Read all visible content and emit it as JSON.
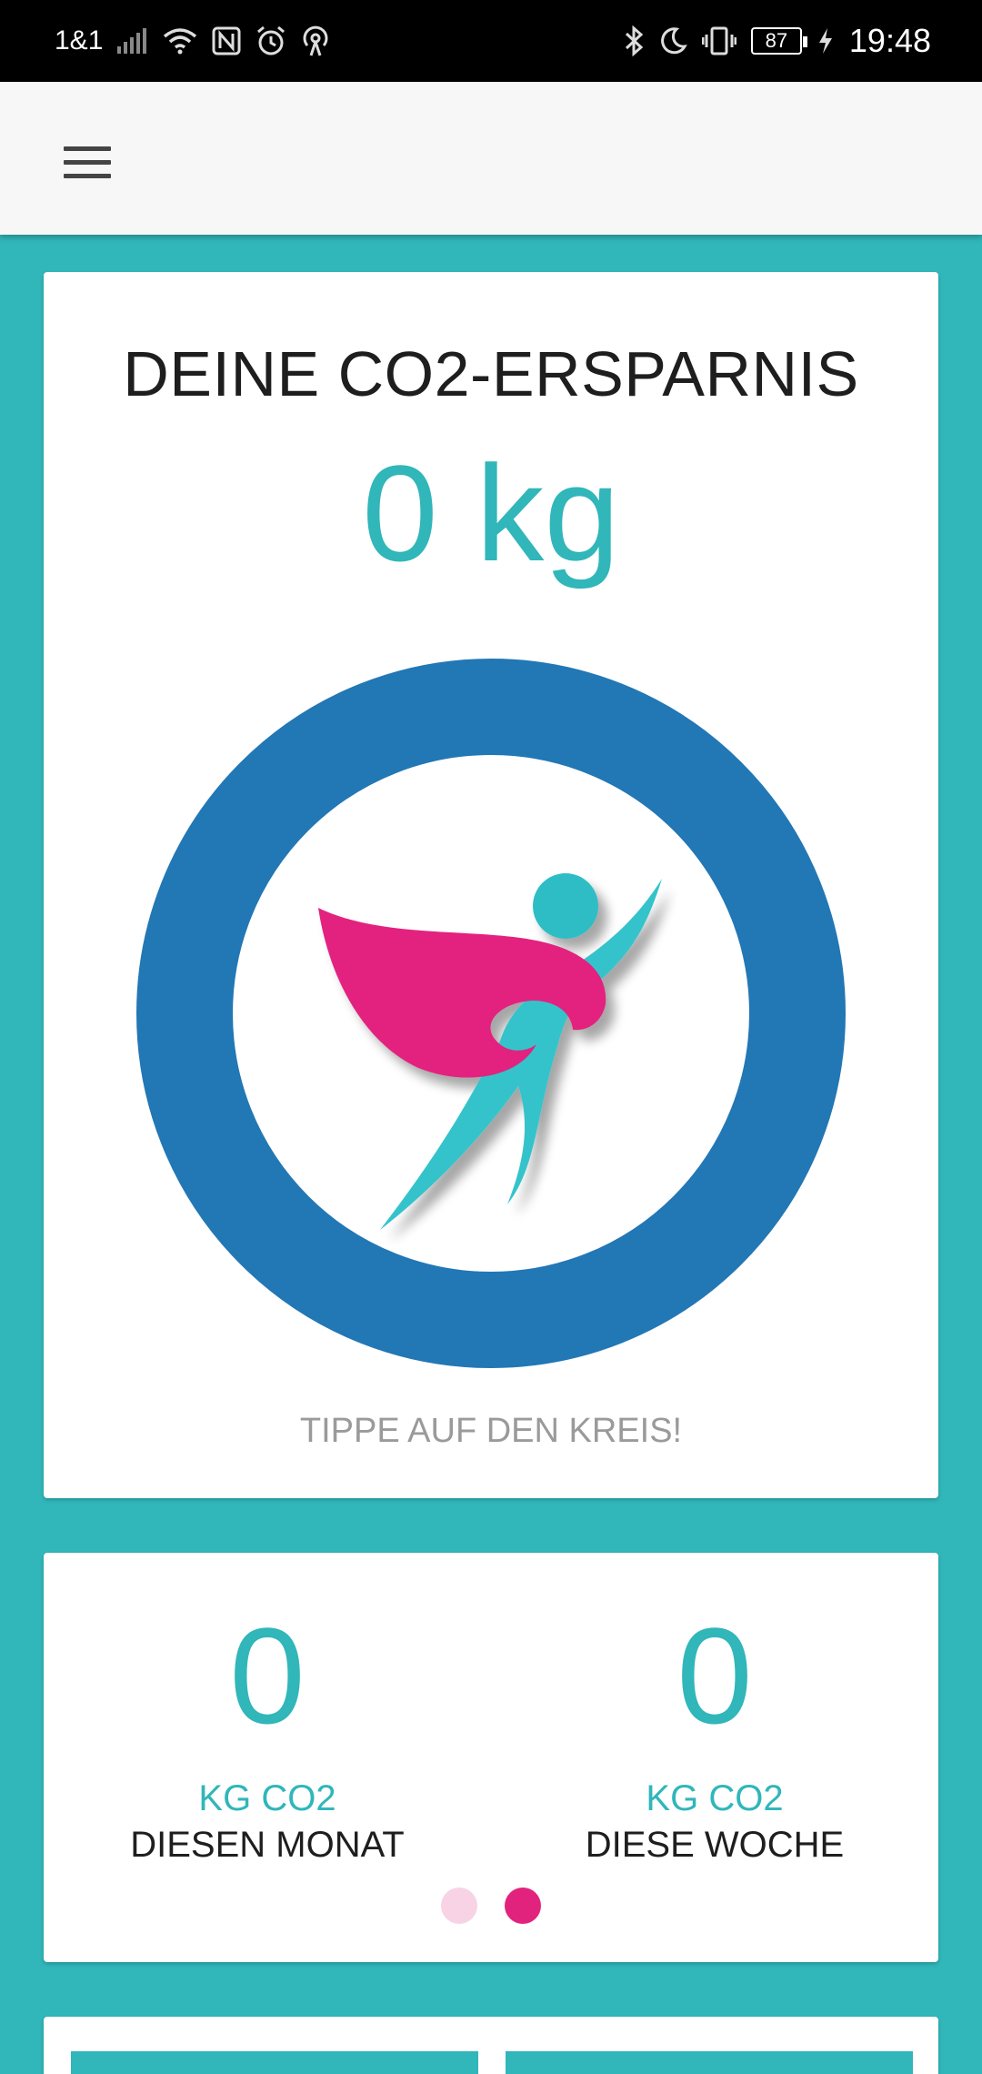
{
  "status_bar": {
    "carrier": "1&1",
    "battery": "87",
    "time": "19:48"
  },
  "savings_card": {
    "title": "DEINE CO2-ERSPARNIS",
    "amount": "0 kg",
    "hint": "TIPPE AUF DEN KREIS!"
  },
  "stats_card": {
    "month": {
      "value": "0",
      "unit": "KG CO2",
      "label": "DIESEN MONAT"
    },
    "week": {
      "value": "0",
      "unit": "KG CO2",
      "label": "DIESE WOCHE"
    },
    "pager": {
      "active_index": 1,
      "count": 2
    }
  },
  "colors": {
    "background": "#31b6ba",
    "ring": "#2277b5",
    "accent_pink": "#e2237e",
    "accent_teal": "#31b6ba"
  }
}
